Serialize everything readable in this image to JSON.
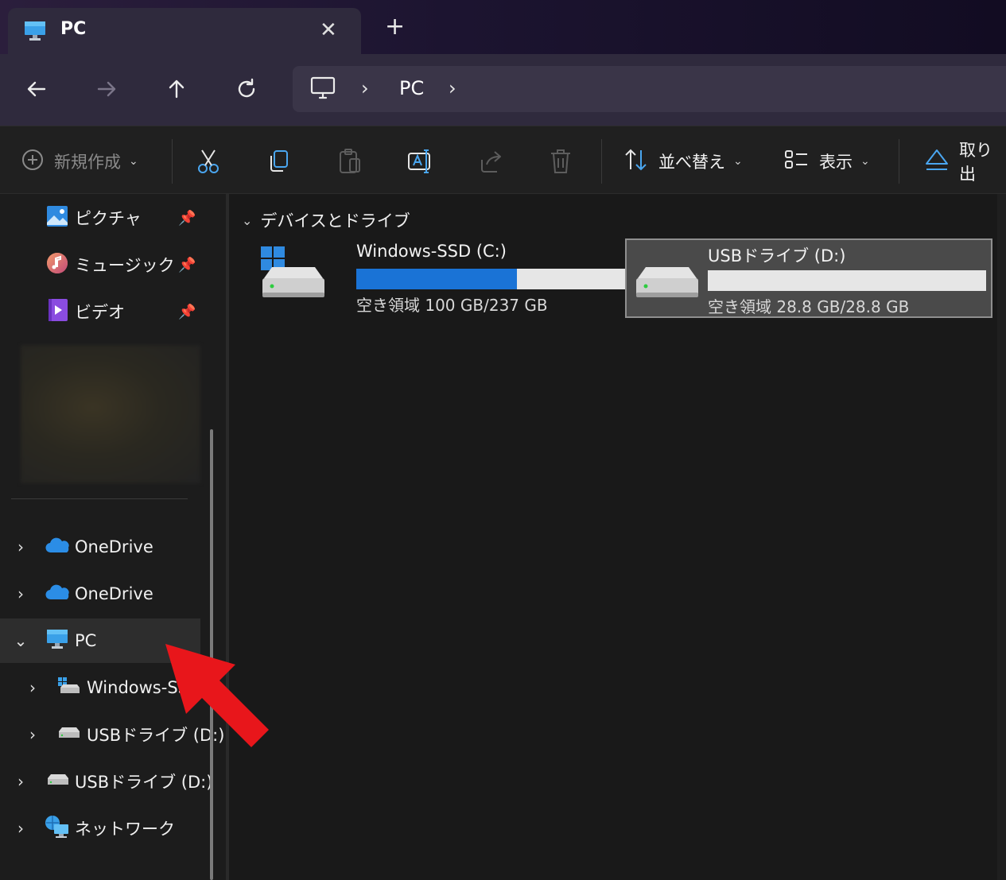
{
  "tab": {
    "title": "PC",
    "close": "✕",
    "new_tab": "+"
  },
  "address_bar": {
    "segments": [
      "PC"
    ]
  },
  "command_bar": {
    "new": "新規作成",
    "sort": "並べ替え",
    "view": "表示",
    "eject": "取り出"
  },
  "sidebar": {
    "quick_access": [
      {
        "label": "ピクチャ",
        "icon": "pictures-icon"
      },
      {
        "label": "ミュージック",
        "icon": "music-icon"
      },
      {
        "label": "ビデオ",
        "icon": "videos-icon"
      }
    ],
    "tree": [
      {
        "label": "OneDrive",
        "icon": "onedrive-icon",
        "expanded": false
      },
      {
        "label": "OneDrive",
        "icon": "onedrive-icon",
        "expanded": false
      },
      {
        "label": "PC",
        "icon": "pc-icon",
        "expanded": true,
        "selected": true
      },
      {
        "label": "Windows-SS",
        "icon": "windows-drive-icon",
        "expanded": false,
        "child": true
      },
      {
        "label": "USBドライブ (D:)",
        "icon": "usb-drive-icon",
        "expanded": false,
        "child": true
      },
      {
        "label": "USBドライブ (D:)",
        "icon": "usb-drive-icon",
        "expanded": false
      },
      {
        "label": "ネットワーク",
        "icon": "network-icon",
        "expanded": false
      }
    ]
  },
  "main": {
    "group_label": "デバイスとドライブ",
    "drives": [
      {
        "name": "Windows-SSD (C:)",
        "free_text": "空き領域 100 GB/237 GB",
        "used_fraction": 0.578,
        "selected": false
      },
      {
        "name": "USBドライブ (D:)",
        "free_text": "空き領域 28.8 GB/28.8 GB",
        "used_fraction": 0.0,
        "selected": true
      }
    ]
  },
  "colors": {
    "accent": "#1a73d6",
    "annotation_arrow": "#e8161b"
  }
}
